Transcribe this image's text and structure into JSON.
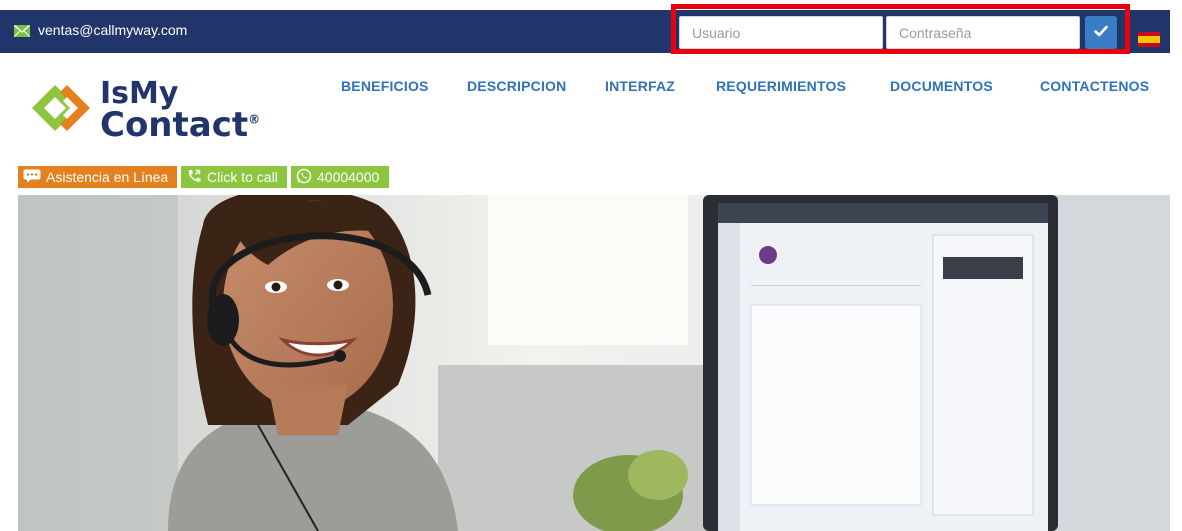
{
  "topbar": {
    "email": "ventas@callmyway.com",
    "email_icon": "envelope-icon",
    "user_placeholder": "Usuario",
    "password_placeholder": "Contraseña",
    "submit_icon": "checkmark-icon",
    "language_icon": "spain-flag-icon"
  },
  "logo": {
    "line1": "IsMy",
    "line2": "Contact",
    "mark": "®"
  },
  "nav": {
    "items": [
      {
        "label": "BENEFICIOS"
      },
      {
        "label": "DESCRIPCION"
      },
      {
        "label": "INTERFAZ"
      },
      {
        "label": "REQUERIMIENTOS"
      },
      {
        "label": "DOCUMENTOS"
      },
      {
        "label": "CONTACTENOS"
      }
    ]
  },
  "help": {
    "chat_label": "Asistencia en Línea",
    "call_label": "Click to call",
    "whatsapp_label": "40004000"
  },
  "colors": {
    "topbar": "#21356a",
    "nav_link": "#2e73b8",
    "highlight": "#e8000f",
    "submit": "#3b7dc4",
    "chat_button": "#e5801e",
    "call_button": "#8cc63f"
  }
}
